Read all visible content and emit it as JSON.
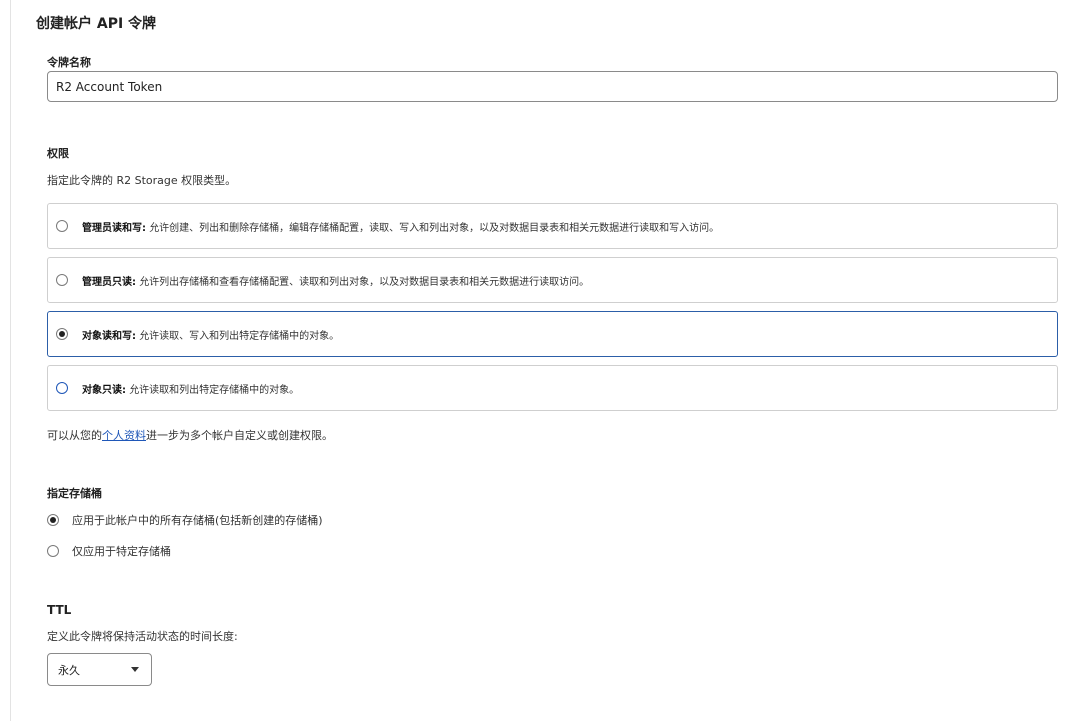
{
  "page": {
    "title": "创建帐户 API 令牌"
  },
  "token_name": {
    "label": "令牌名称",
    "value": "R2 Account Token",
    "placeholder": ""
  },
  "permissions": {
    "label": "权限",
    "description": "指定此令牌的 R2 Storage 权限类型。",
    "options": [
      {
        "title": "管理员读和写:",
        "text": "允许创建、列出和删除存储桶，编辑存储桶配置，读取、写入和列出对象，以及对数据目录表和相关元数据进行读取和写入访问。",
        "selected": false
      },
      {
        "title": "管理员只读:",
        "text": "允许列出存储桶和查看存储桶配置、读取和列出对象，以及对数据目录表和相关元数据进行读取访问。",
        "selected": false
      },
      {
        "title": "对象读和写:",
        "text": "允许读取、写入和列出特定存储桶中的对象。",
        "selected": true
      },
      {
        "title": "对象只读:",
        "text": "允许读取和列出特定存储桶中的对象。",
        "selected": false
      }
    ],
    "helper_prefix": "可以从您的",
    "helper_link": "个人资料",
    "helper_suffix": "进一步为多个帐户自定义或创建权限。"
  },
  "buckets": {
    "label": "指定存储桶",
    "options": [
      {
        "text": "应用于此帐户中的所有存储桶(包括新创建的存储桶)",
        "selected": true
      },
      {
        "text": "仅应用于特定存储桶",
        "selected": false
      }
    ]
  },
  "ttl": {
    "label": "TTL",
    "description": "定义此令牌将保持活动状态的时间长度:",
    "selected": "永久"
  }
}
